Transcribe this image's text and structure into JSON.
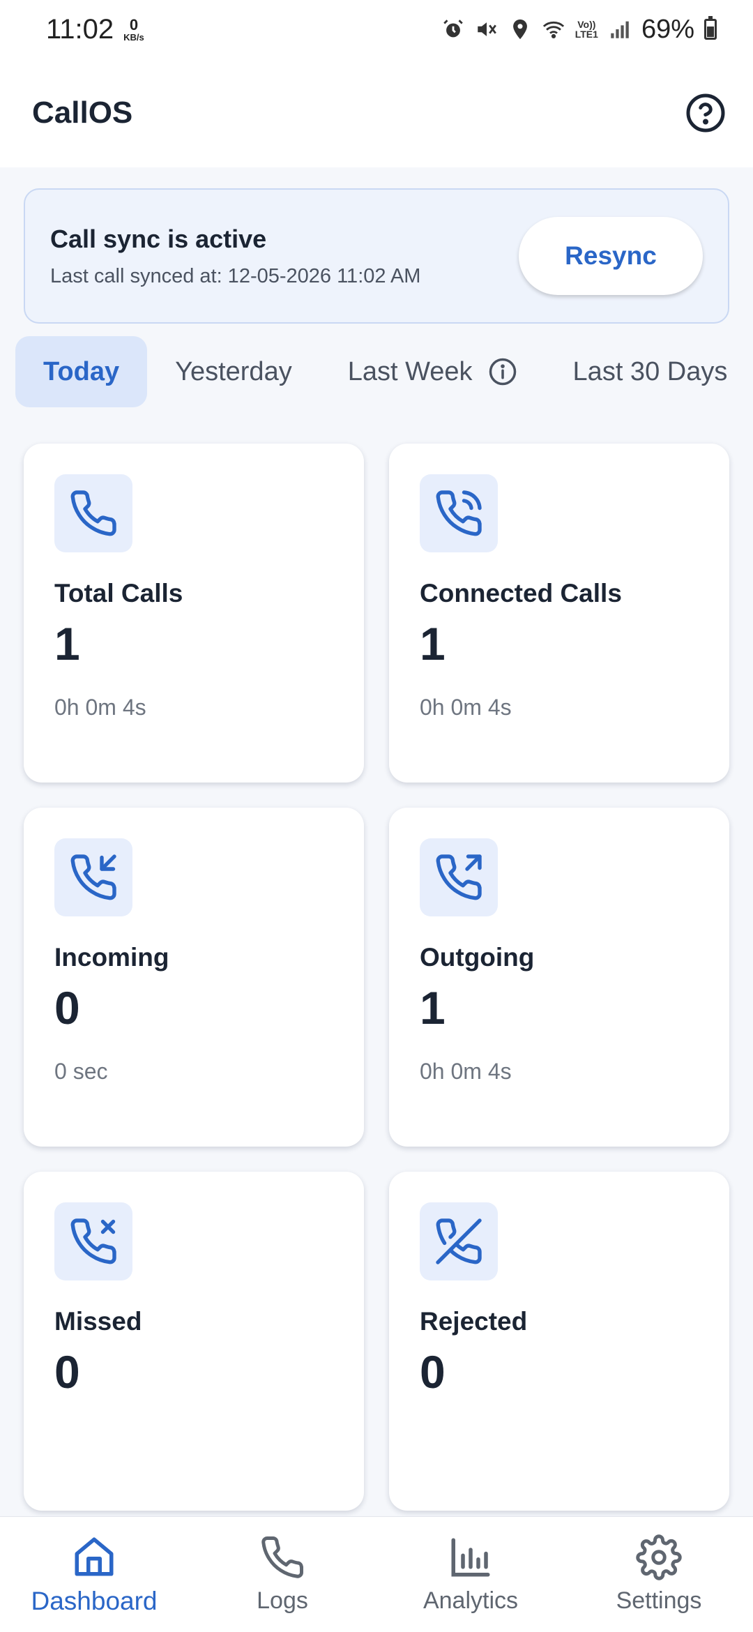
{
  "status_bar": {
    "time": "11:02",
    "net_speed_value": "0",
    "net_speed_unit": "KB/s",
    "lte_top": "Vo))",
    "lte_bottom": "LTE1",
    "battery": "69%"
  },
  "app_bar": {
    "title": "CallOS",
    "help_icon": "help-circle-icon"
  },
  "sync": {
    "title": "Call sync is active",
    "subtitle": "Last call synced at: 12-05-2026 11:02 AM",
    "resync_label": "Resync"
  },
  "tabs": [
    {
      "label": "Today",
      "active": true
    },
    {
      "label": "Yesterday",
      "active": false
    },
    {
      "label": "Last Week",
      "active": false,
      "icon": "info-icon"
    },
    {
      "label": "Last 30 Days",
      "active": false
    }
  ],
  "cards": [
    {
      "label": "Total Calls",
      "value": "1",
      "duration": "0h 0m 4s",
      "icon": "phone-icon"
    },
    {
      "label": "Connected Calls",
      "value": "1",
      "duration": "0h 0m 4s",
      "icon": "phone-connected-icon"
    },
    {
      "label": "Incoming",
      "value": "0",
      "duration": "0 sec",
      "icon": "phone-incoming-icon"
    },
    {
      "label": "Outgoing",
      "value": "1",
      "duration": "0h 0m 4s",
      "icon": "phone-outgoing-icon"
    },
    {
      "label": "Missed",
      "value": "0",
      "duration": "",
      "icon": "phone-missed-icon"
    },
    {
      "label": "Rejected",
      "value": "0",
      "duration": "",
      "icon": "phone-off-icon"
    }
  ],
  "bottom_nav": [
    {
      "label": "Dashboard",
      "icon": "home-icon",
      "active": true
    },
    {
      "label": "Logs",
      "icon": "phone-icon",
      "active": false
    },
    {
      "label": "Analytics",
      "icon": "bar-chart-icon",
      "active": false
    },
    {
      "label": "Settings",
      "icon": "gear-icon",
      "active": false
    }
  ],
  "colors": {
    "accent": "#2a66c7",
    "icon_bg": "#e7eefc",
    "sync_bg": "#eef3fc",
    "page_bg": "#f5f7fb"
  }
}
